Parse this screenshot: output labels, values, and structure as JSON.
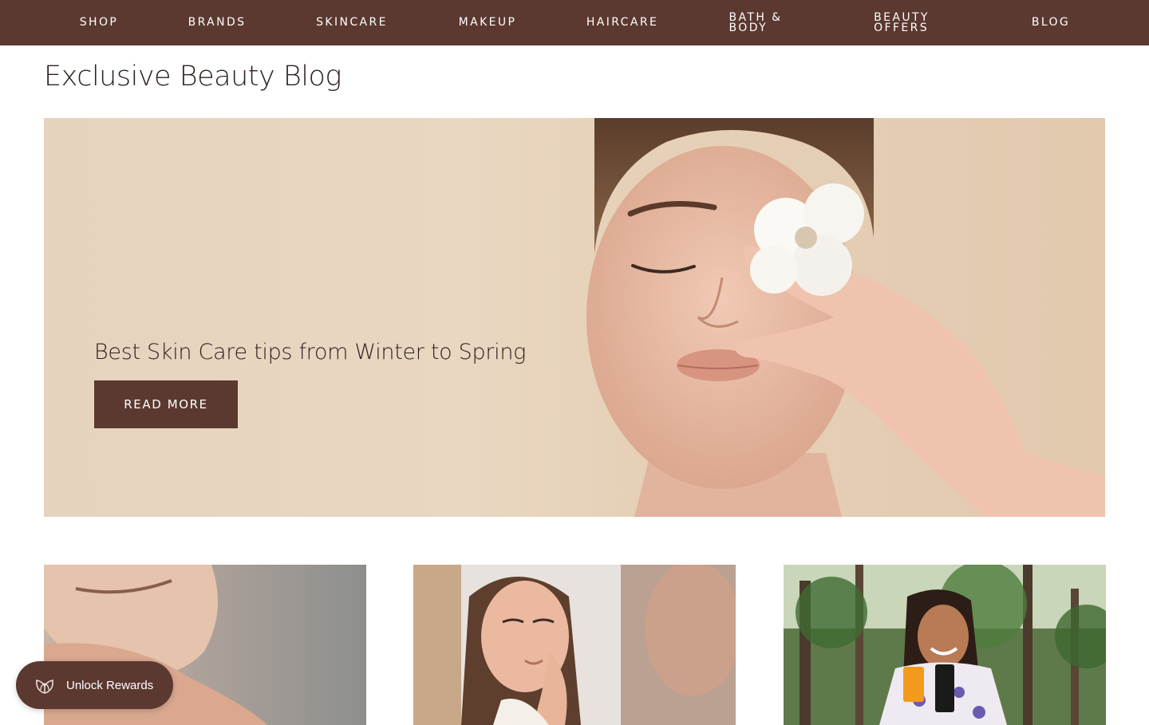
{
  "nav": {
    "items": [
      {
        "label": "SHOP"
      },
      {
        "label": "BRANDS"
      },
      {
        "label": "SKINCARE"
      },
      {
        "label": "MAKEUP"
      },
      {
        "label": "HAIRCARE"
      },
      {
        "label": "BATH &\nBODY"
      },
      {
        "label": "BEAUTY\nOFFERS"
      },
      {
        "label": "BLOG"
      }
    ]
  },
  "page": {
    "title": "Exclusive Beauty Blog"
  },
  "hero": {
    "headline": "Best Skin Care tips from Winter to Spring",
    "button_label": "READ MORE"
  },
  "rewards": {
    "label": "Unlock Rewards",
    "icon": "leaf-icon"
  },
  "colors": {
    "brand": "#5b3830",
    "hero_bg": "#e6d3bd",
    "text": "#2f2220"
  }
}
